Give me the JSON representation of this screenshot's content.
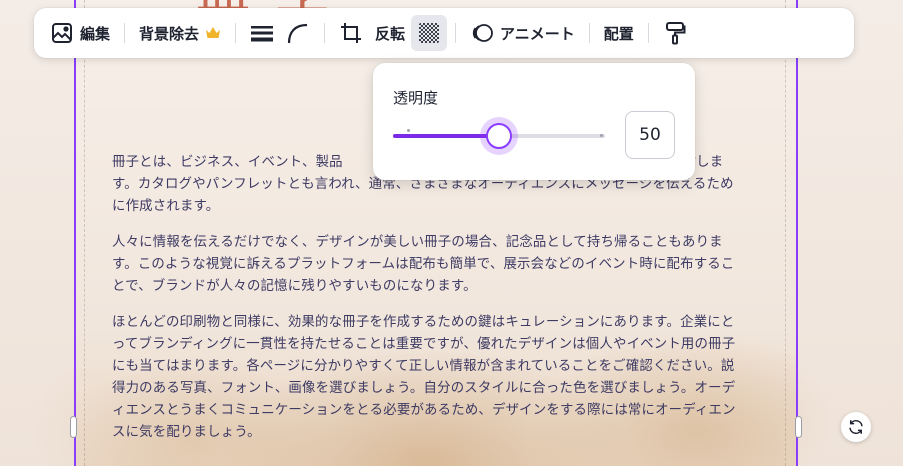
{
  "toolbar": {
    "edit_label": "編集",
    "bg_remove_label": "背景除去",
    "flip_label": "反転",
    "animate_label": "アニメート",
    "position_label": "配置"
  },
  "transparency": {
    "title": "透明度",
    "value": "50",
    "value_num": 50,
    "min": 0,
    "max": 100
  },
  "heading_partial": "冊 子",
  "body": {
    "paragraph1": "冊子とは、ビジネス、イベント、製品　　　　　　　　　　　　　　　以上の印刷物のことを指します。カタログやパンフレットとも言われ、通常、さまざまなオーディエンスにメッセージを伝えるために作成されます。",
    "paragraph2": "人々に情報を伝えるだけでなく、デザインが美しい冊子の場合、記念品として持ち帰ることもあります。このような視覚に訴えるプラットフォームは配布も簡単で、展示会などのイベント時に配布することで、ブランドが人々の記憶に残りやすいものになります。",
    "paragraph3": "ほとんどの印刷物と同様に、効果的な冊子を作成するための鍵はキュレーションにあります。企業にとってブランディングに一貫性を持たせることは重要ですが、優れたデザインは個人やイベント用の冊子にも当てはまります。各ページに分かりやすくて正しい情報が含まれていることをご確認ください。説得力のある写真、フォント、画像を選びましょう。自分のスタイルに合った色を選びましょう。オーディエンスとうまくコミュニケーションをとる必要があるため、デザインをする際には常にオーディエンスに気を配りましょう。"
  },
  "colors": {
    "accent": "#8b3dff",
    "slider_fill": "#7d2ae8",
    "text": "#3d3a63",
    "crown": "#f0b429"
  }
}
